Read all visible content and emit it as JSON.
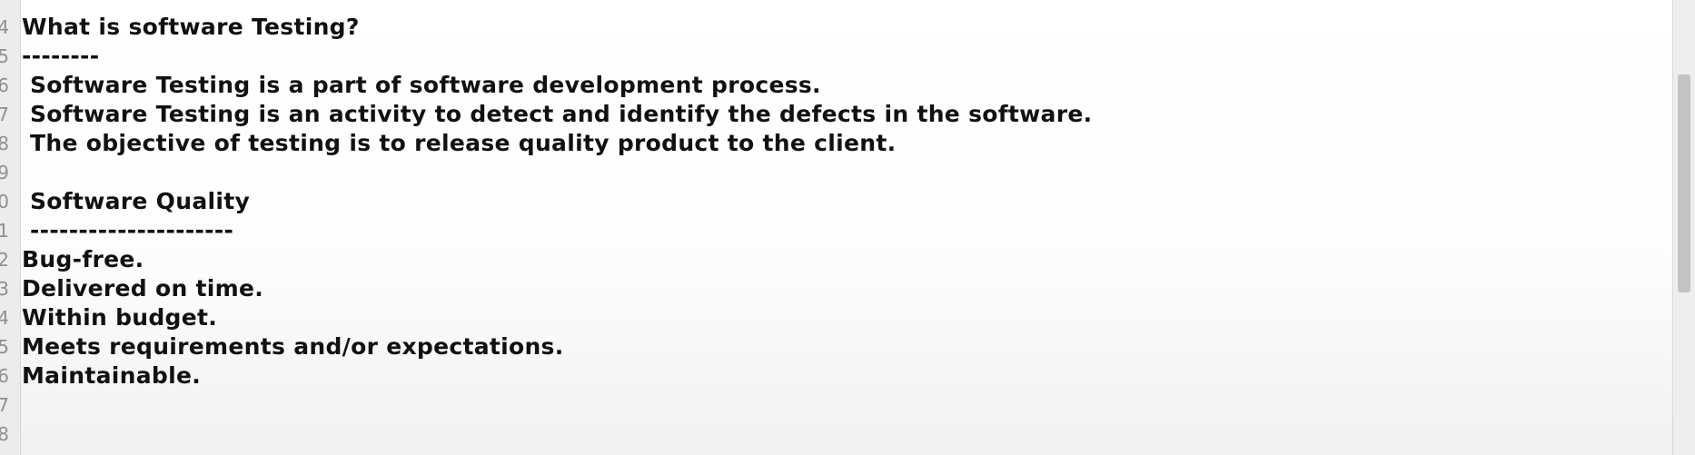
{
  "editor": {
    "line_numbers": [
      "4",
      "5",
      "6",
      "7",
      "8",
      "9",
      "0",
      "1",
      "2",
      "3",
      "4",
      "5",
      "6",
      "7",
      "8"
    ],
    "lines": [
      "What is software Testing?",
      "--------",
      " Software Testing is a part of software development process.",
      " Software Testing is an activity to detect and identify the defects in the software.",
      " The objective of testing is to release quality product to the client.",
      "",
      " Software Quality",
      " ---------------------",
      "Bug-free.",
      "Delivered on time.",
      "Within budget.",
      "Meets requirements and/or expectations.",
      "Maintainable."
    ]
  }
}
